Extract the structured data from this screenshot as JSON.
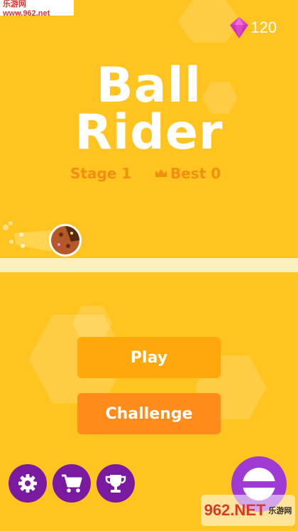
{
  "watermark": {
    "site": "乐游网 www.962.net"
  },
  "header": {
    "gems_count": "120",
    "gem_icon": "diamond-icon"
  },
  "title": {
    "line1": "Ball",
    "line2": "Rider"
  },
  "stats": {
    "stage": "Stage 1",
    "best": "Best 0",
    "best_icon": "crown-icon"
  },
  "buttons": {
    "play": "Play",
    "challenge": "Challenge"
  },
  "bottom_bar": {
    "icons": [
      "gear-icon",
      "cart-icon",
      "trophy-icon",
      "ball-skin-icon"
    ]
  },
  "logo_watermark": {
    "brand": "962.NET",
    "sub": "乐游网"
  },
  "colors": {
    "background": "#ffc41f",
    "title": "#ffffff",
    "stats_text": "#f08f10",
    "play_button": "#ffa80b",
    "challenge_button": "#ff8b1a",
    "round_button": "#7a1aa0",
    "gem": "#e040c8",
    "track": "#fdf0bf"
  }
}
